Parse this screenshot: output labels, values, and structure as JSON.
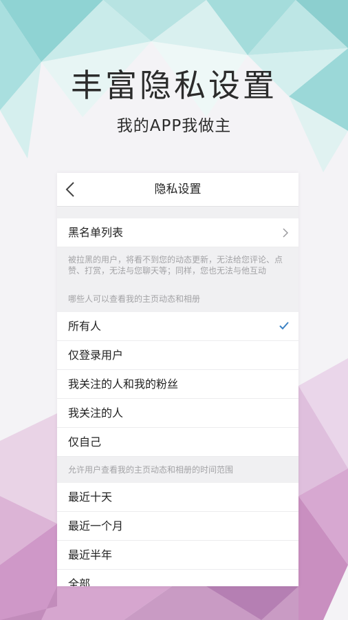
{
  "promo": {
    "headline": "丰富隐私设置",
    "subline": "我的APP我做主"
  },
  "screen": {
    "title": "隐私设置",
    "blacklist": {
      "label": "黑名单列表",
      "description": "被拉黑的用户，将看不到您的动态更新，无法给您评论、点 赞、打赏，无法与您聊天等；同样，您也无法与他互动"
    },
    "visibility": {
      "header": "哪些人可以查看我的主页动态和相册",
      "options": [
        "所有人",
        "仅登录用户",
        "我关注的人和我的粉丝",
        "我关注的人",
        "仅自己"
      ],
      "selected": "所有人"
    },
    "time_range": {
      "header": "允许用户查看我的主页动态和相册的时间范围",
      "options": [
        "最近十天",
        "最近一个月",
        "最近半年",
        "全部"
      ]
    }
  },
  "colors": {
    "check": "#3b82c4",
    "teal": "#8fd6d6",
    "pink": "#d490c0"
  }
}
